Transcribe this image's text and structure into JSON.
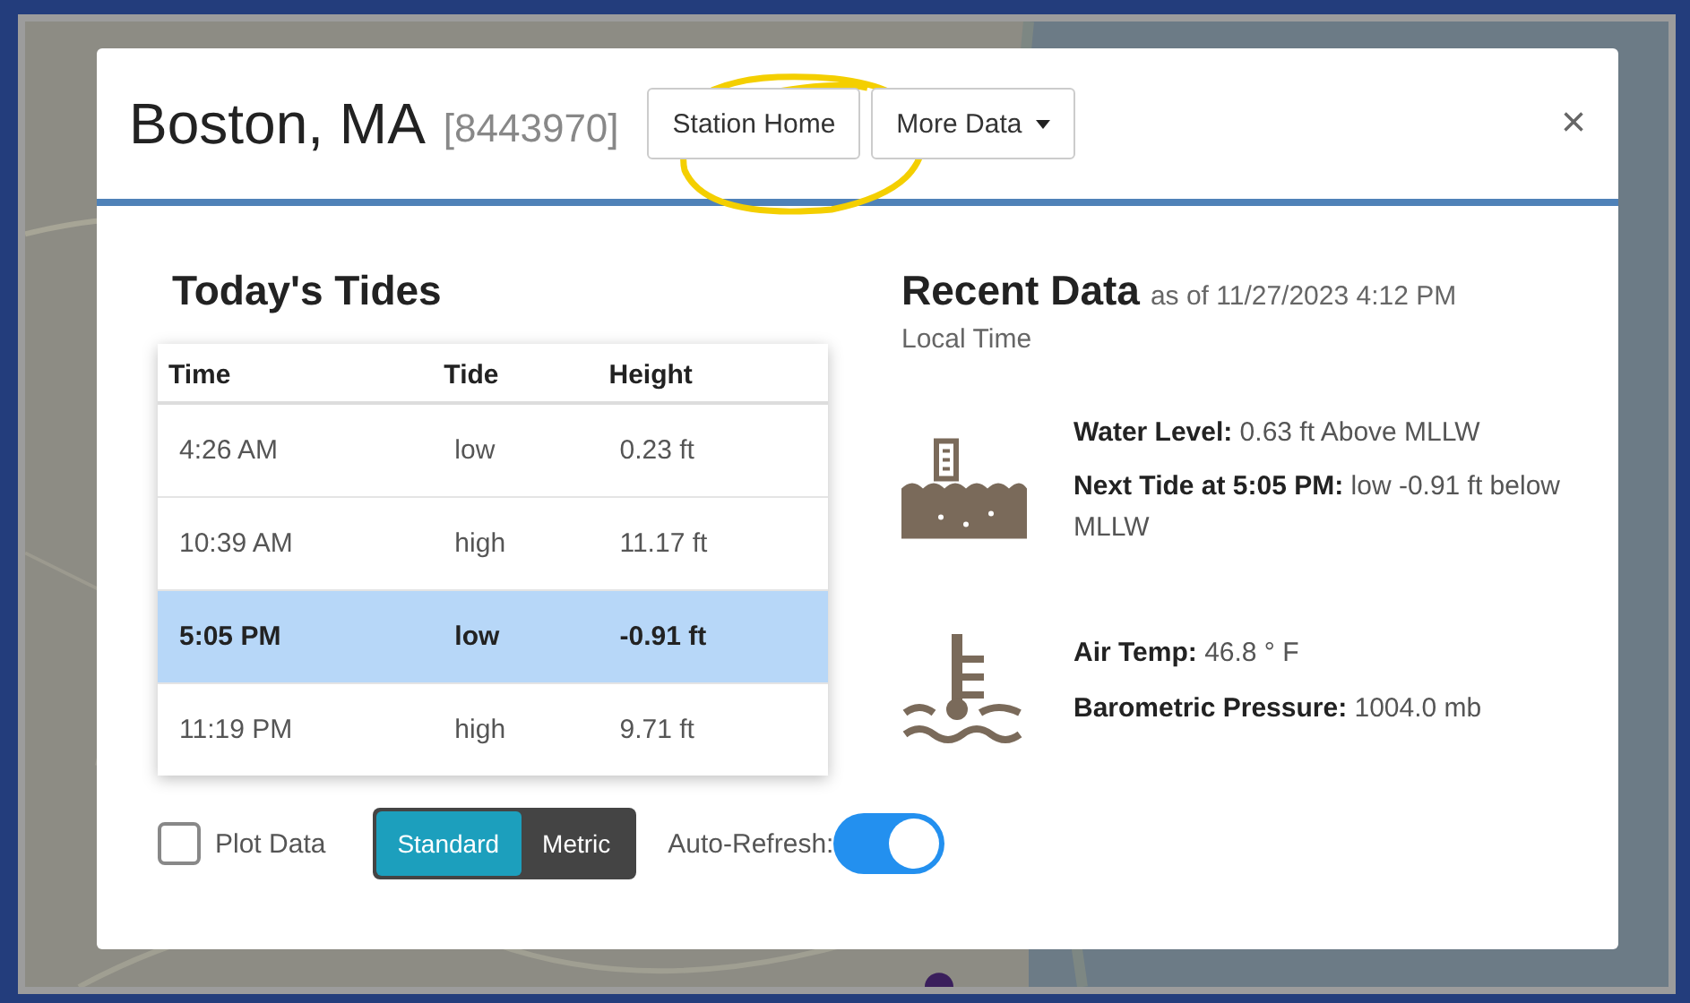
{
  "station": {
    "name": "Boston, MA",
    "id": "[8443970]"
  },
  "header_buttons": [
    {
      "label": "Station Home",
      "dropdown": false
    },
    {
      "label": "More Data",
      "dropdown": true
    }
  ],
  "close": "×",
  "tides": {
    "title": "Today's Tides",
    "columns": [
      "Time",
      "Tide",
      "Height"
    ],
    "rows": [
      {
        "time": "4:26 AM",
        "tide": "low",
        "height": "0.23 ft",
        "selected": false
      },
      {
        "time": "10:39 AM",
        "tide": "high",
        "height": "11.17 ft",
        "selected": false
      },
      {
        "time": "5:05 PM",
        "tide": "low",
        "height": "-0.91 ft",
        "selected": true
      },
      {
        "time": "11:19 PM",
        "tide": "high",
        "height": "9.71 ft",
        "selected": false
      }
    ]
  },
  "plot_data": {
    "label": "Plot Data",
    "checked": false
  },
  "units": [
    {
      "label": "Standard",
      "selected": true
    },
    {
      "label": "Metric",
      "selected": false
    }
  ],
  "auto_refresh": {
    "label": "Auto-Refresh:",
    "on": true
  },
  "recent": {
    "title": "Recent Data",
    "subtitle": "as of 11/27/2023 4:12 PM",
    "subtitle_2": "Local Time",
    "groups": [
      {
        "kind": "water",
        "lines": [
          "**Water Level:** 0.63 ft Above MLLW",
          "**Next Tide at 5:05 PM:** low -0.91 ft below MLLW"
        ]
      },
      {
        "kind": "temperature",
        "lines": [
          "**Air Temp:** 46.8 ° F",
          "**Barometric Pressure:** 1004.0 mb"
        ]
      }
    ]
  }
}
